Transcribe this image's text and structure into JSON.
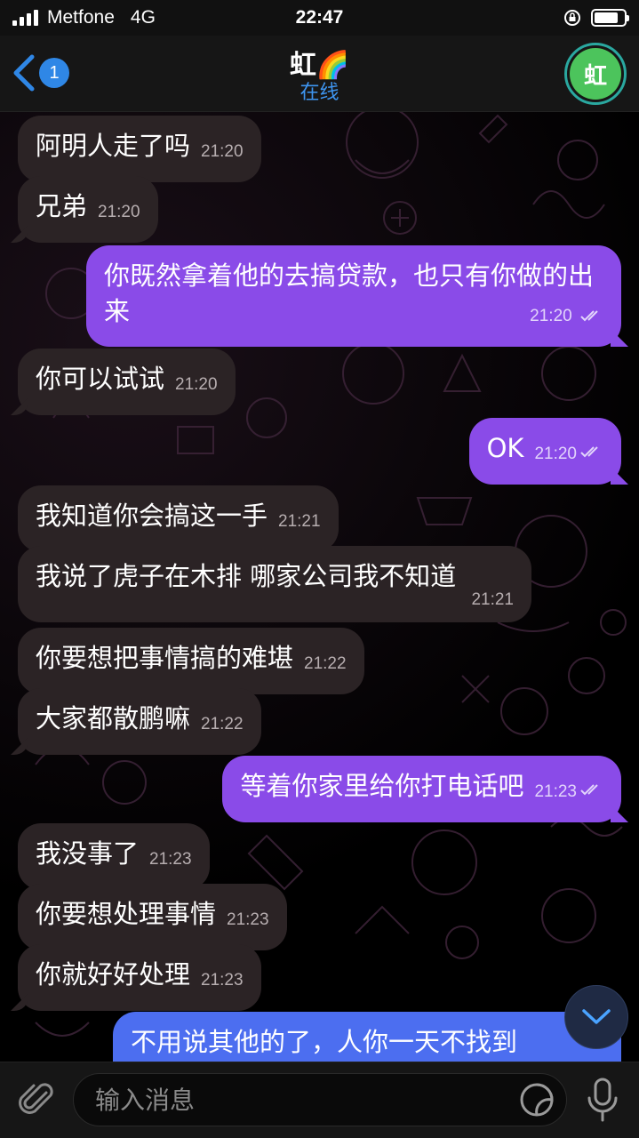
{
  "status_bar": {
    "carrier": "Metfone",
    "network": "4G",
    "time": "22:47"
  },
  "header": {
    "back_badge": "1",
    "title": "虹🌈",
    "status": "在线",
    "avatar_letter": "虹"
  },
  "messages": [
    {
      "direction": "in",
      "text": "阿明人走了吗",
      "time": "21:20"
    },
    {
      "direction": "in",
      "text": "兄弟",
      "time": "21:20"
    },
    {
      "direction": "out",
      "text": "你既然拿着他的去搞贷款，也只有你做的出来",
      "time": "21:20"
    },
    {
      "direction": "in",
      "text": "你可以试试",
      "time": "21:20"
    },
    {
      "direction": "out",
      "text": "OK",
      "time": "21:20"
    },
    {
      "direction": "in",
      "text": "我知道你会搞这一手",
      "time": "21:21"
    },
    {
      "direction": "in",
      "text": "我说了虎子在木排 哪家公司我不知道",
      "time": "21:21"
    },
    {
      "direction": "in",
      "text": "你要想把事情搞的难堪",
      "time": "21:22"
    },
    {
      "direction": "in",
      "text": "大家都散鹏嘛",
      "time": "21:22"
    },
    {
      "direction": "out",
      "text": "等着你家里给你打电话吧",
      "time": "21:23"
    },
    {
      "direction": "in",
      "text": "我没事了",
      "time": "21:23"
    },
    {
      "direction": "in",
      "text": "你要想处理事情",
      "time": "21:23"
    },
    {
      "direction": "in",
      "text": "你就好好处理",
      "time": "21:23"
    },
    {
      "direction": "out",
      "text": "不用说其他的了，人你一天不找到",
      "time": ""
    }
  ],
  "input": {
    "placeholder": "输入消息"
  },
  "colors": {
    "incoming_bubble": "#2b2325",
    "outgoing_bubble": "#8a4be8",
    "accent": "#2f87e6",
    "avatar": "#4cc45c"
  }
}
